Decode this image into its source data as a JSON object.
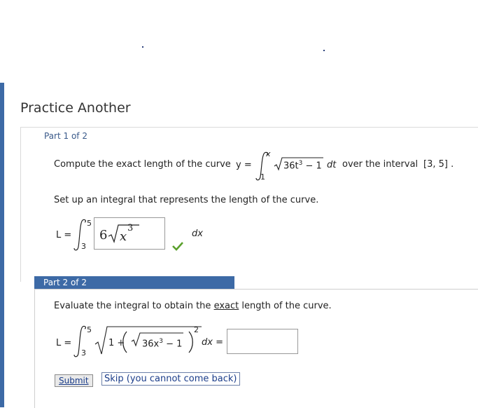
{
  "heading": "Practice Another",
  "part1": {
    "label": "Part 1 of 2",
    "prompt_pre": "Compute the exact length of the curve",
    "y_eq": "y =",
    "int_upper": "x",
    "int_lower": "1",
    "integrand": "36t",
    "integrand_exp": "3",
    "integrand_tail": "− 1",
    "dt": "dt",
    "prompt_post": "over the interval",
    "interval": "[3, 5] .",
    "setup_text": "Set up an integral that represents the length of the curve.",
    "L_eq": "L =",
    "lim_upper": "5",
    "lim_lower": "3",
    "answer_coef": "6",
    "answer_var": "x",
    "answer_exp": "3",
    "dx": "dx",
    "status": "correct"
  },
  "part2": {
    "label": "Part 2 of 2",
    "prompt_pre": "Evaluate the integral to obtain the",
    "prompt_emph": "exact",
    "prompt_post": "length of the curve.",
    "L_eq": "L =",
    "lim_upper": "5",
    "lim_lower": "3",
    "one_plus": "1 +",
    "inner": "36x",
    "inner_exp": "3",
    "inner_tail": "− 1",
    "outer_exp": "2",
    "dx_eq": "dx =",
    "answer_value": ""
  },
  "buttons": {
    "submit": "Submit",
    "skip": "Skip (you cannot come back)"
  },
  "colors": {
    "accent": "#3d6aa6",
    "check": "#5aa02c"
  }
}
